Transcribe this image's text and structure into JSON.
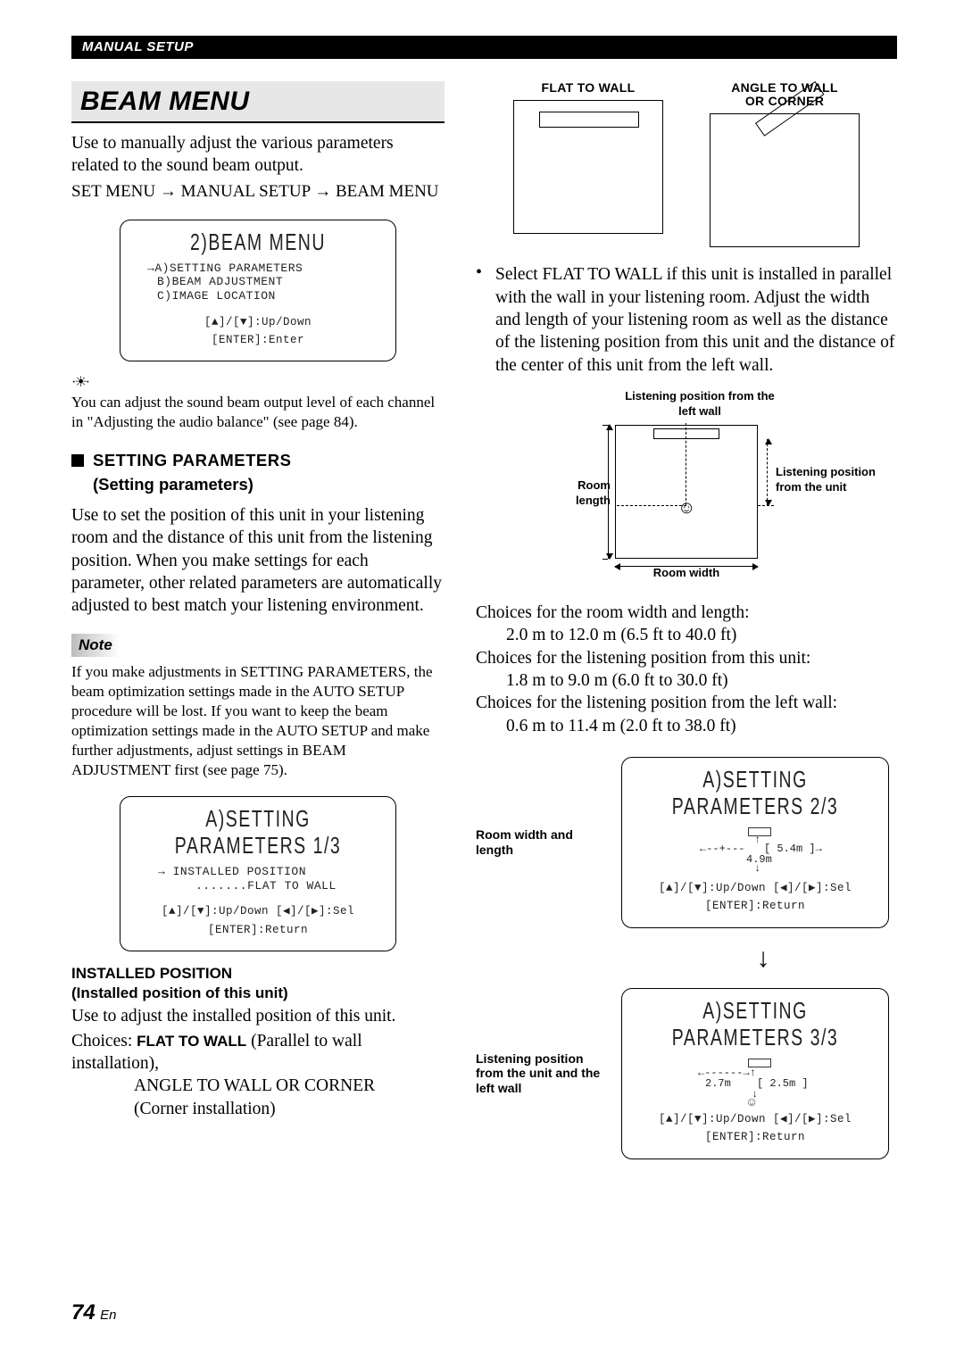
{
  "header": {
    "section": "MANUAL SETUP"
  },
  "title": "BEAM MENU",
  "intro": "Use to manually adjust the various parameters related to the sound beam output.",
  "nav": {
    "a": "SET MENU",
    "b": "MANUAL SETUP",
    "c": "BEAM MENU"
  },
  "lcd_main": {
    "title": "2)BEAM MENU",
    "item_a": "A)SETTING PARAMETERS",
    "item_b": "B)BEAM ADJUSTMENT",
    "item_c": "C)IMAGE LOCATION",
    "hint1": "[▲]/[▼]:Up/Down",
    "hint2": "[ENTER]:Enter"
  },
  "tip": "You can adjust the sound beam output level of each channel in \"Adjusting the audio balance\" (see page 84).",
  "subhead": {
    "line1": "SETTING PARAMETERS",
    "line2": "(Setting parameters)"
  },
  "setting_para": "Use to set the position of this unit in your listening room and the distance of this unit from the listening position. When you make settings for each parameter, other related parameters are automatically adjusted to best match your listening environment.",
  "note_label": "Note",
  "note_text": "If you make adjustments in SETTING PARAMETERS, the beam optimization settings made in the AUTO SETUP procedure will be lost. If you want to keep the beam optimization settings made in the AUTO SETUP and make further adjustments, adjust settings in BEAM ADJUSTMENT first (see page 75).",
  "lcd_a1": {
    "title": "A)SETTING PARAMETERS 1/3",
    "line1": "→ INSTALLED POSITION",
    "line2": ".......FLAT TO WALL",
    "hint1": "[▲]/[▼]:Up/Down [◀]/[▶]:Sel",
    "hint2": "[ENTER]:Return"
  },
  "installed": {
    "head1": "INSTALLED POSITION",
    "head2": "(Installed position of this unit)",
    "body": "Use to adjust the installed position of this unit.",
    "choices_pre": "Choices: ",
    "choice1": "FLAT TO WALL",
    "choice1_post": " (Parallel to wall installation), ",
    "choice2": "ANGLE TO WALL OR CORNER ",
    "choice2_post": "(Corner installation)"
  },
  "right_top": {
    "flat_label": "FLAT TO WALL",
    "angle_label_l1": "ANGLE TO WALL",
    "angle_label_l2": "OR CORNER"
  },
  "right_bullet": "Select FLAT TO WALL if this unit is installed in parallel with the wall in your listening room. Adjust the width and length of your listening room as well as the distance of the listening position from this unit and the distance of the center of this unit from the left wall.",
  "room_labels": {
    "lp_left": "Listening position from the left wall",
    "room_length": "Room length",
    "lp_unit": "Listening position from the unit",
    "room_width": "Room width"
  },
  "choices_block": {
    "c1": "Choices for the room width and length:",
    "c1v": "2.0 m to 12.0 m (6.5 ft to 40.0 ft)",
    "c2": "Choices for the listening position from this unit:",
    "c2v": "1.8 m to 9.0 m (6.0 ft to 30.0 ft)",
    "c3": "Choices for the listening position from the left wall:",
    "c3v": "0.6 m to 11.4 m (2.0 ft to 38.0 ft)"
  },
  "lcd_a2": {
    "title": "A)SETTING PARAMETERS 2/3",
    "side": "Room width and length",
    "dim_h": "[ 5.4m ]→",
    "dim_v": "4.9m",
    "hint1": "[▲]/[▼]:Up/Down [◀]/[▶]:Sel",
    "hint2": "[ENTER]:Return"
  },
  "lcd_a3": {
    "title": "A)SETTING PARAMETERS 3/3",
    "side": "Listening position from the unit and the left wall",
    "dim1": "2.7m",
    "dim2": "[ 2.5m ]",
    "hint1": "[▲]/[▼]:Up/Down [◀]/[▶]:Sel",
    "hint2": "[ENTER]:Return"
  },
  "page": {
    "num": "74",
    "lang": "En"
  }
}
